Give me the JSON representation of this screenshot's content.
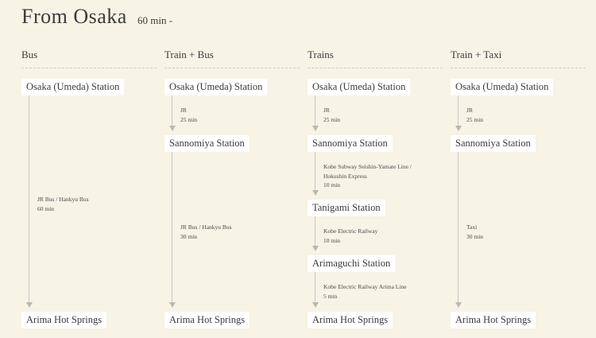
{
  "page": {
    "title": "From Osaka",
    "duration": "60 min -"
  },
  "colors": {
    "background": "#f7f3e5",
    "station_box": "#ffffff",
    "connector": "#c5c5c5"
  },
  "routes": [
    {
      "header": "Bus",
      "stations": [
        "Osaka (Umeda) Station",
        "Arima Hot Springs"
      ],
      "segments": [
        {
          "lines": [
            "JR Bus / Hankyu Bus",
            "60 min"
          ]
        }
      ]
    },
    {
      "header": "Train + Bus",
      "stations": [
        "Osaka (Umeda) Station",
        "Sannomiya Station",
        "Arima Hot Springs"
      ],
      "segments": [
        {
          "lines": [
            "JR",
            "25 min"
          ]
        },
        {
          "lines": [
            "JR Bus / Hankyu Bus",
            "30 min"
          ]
        }
      ]
    },
    {
      "header": "Trains",
      "stations": [
        "Osaka (Umeda) Station",
        "Sannomiya Station",
        "Tanigami Station",
        "Arimaguchi Station",
        "Arima Hot Springs"
      ],
      "segments": [
        {
          "lines": [
            "JR",
            "25 min"
          ]
        },
        {
          "lines": [
            "Kobe Subway Seishin-Yamate Line /",
            "Hokushin Express",
            "10 min"
          ]
        },
        {
          "lines": [
            "Kobe Electric Railway",
            "10 min"
          ]
        },
        {
          "lines": [
            "Kobe Electric Railway Arima Line",
            "5 min"
          ]
        }
      ]
    },
    {
      "header": "Train + Taxi",
      "stations": [
        "Osaka (Umeda) Station",
        "Sannomiya Station",
        "Arima Hot Springs"
      ],
      "segments": [
        {
          "lines": [
            "JR",
            "25 min"
          ]
        },
        {
          "lines": [
            "Taxi",
            "30 min"
          ]
        }
      ]
    }
  ]
}
